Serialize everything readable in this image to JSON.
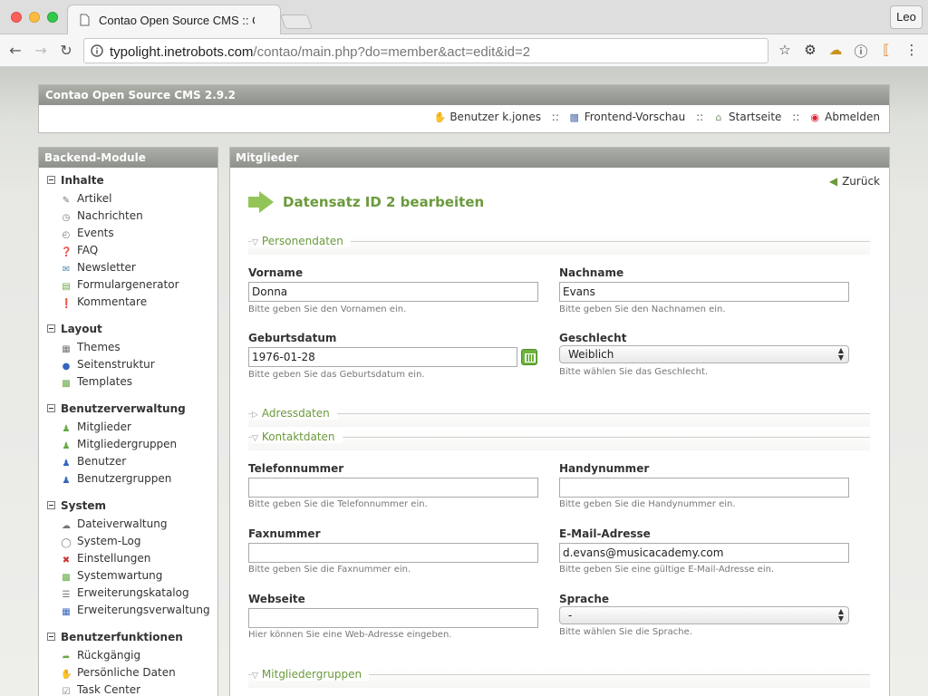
{
  "browser": {
    "tab_title": "Contao Open Source CMS :: Contao",
    "user": "Leo",
    "url_host": "typolight.inetrobots.com",
    "url_path": "/contao/main.php?do=member&act=edit&id=2"
  },
  "header": {
    "title": "Contao Open Source CMS 2.9.2",
    "user_link": "Benutzer k.jones",
    "preview_link": "Frontend-Vorschau",
    "home_link": "Startseite",
    "logout_link": "Abmelden",
    "separator": "::"
  },
  "sidebar": {
    "title": "Backend-Module",
    "groups": [
      {
        "title": "Inhalte",
        "items": [
          "Artikel",
          "Nachrichten",
          "Events",
          "FAQ",
          "Newsletter",
          "Formulargenerator",
          "Kommentare"
        ]
      },
      {
        "title": "Layout",
        "items": [
          "Themes",
          "Seitenstruktur",
          "Templates"
        ]
      },
      {
        "title": "Benutzerverwaltung",
        "items": [
          "Mitglieder",
          "Mitgliedergruppen",
          "Benutzer",
          "Benutzergruppen"
        ]
      },
      {
        "title": "System",
        "items": [
          "Dateiverwaltung",
          "System-Log",
          "Einstellungen",
          "Systemwartung",
          "Erweiterungskatalog",
          "Erweiterungsverwaltung"
        ]
      },
      {
        "title": "Benutzerfunktionen",
        "items": [
          "Rückgängig",
          "Persönliche Daten",
          "Task Center"
        ]
      }
    ]
  },
  "main": {
    "title": "Mitglieder",
    "back": "Zurück",
    "heading": "Datensatz ID 2 bearbeiten",
    "legends": {
      "personal": "Personendaten",
      "address": "Adressdaten",
      "contact": "Kontaktdaten",
      "groups": "Mitgliedergruppen"
    },
    "fields": {
      "firstname": {
        "label": "Vorname",
        "value": "Donna",
        "help": "Bitte geben Sie den Vornamen ein."
      },
      "lastname": {
        "label": "Nachname",
        "value": "Evans",
        "help": "Bitte geben Sie den Nachnamen ein."
      },
      "dob": {
        "label": "Geburtsdatum",
        "value": "1976-01-28",
        "help": "Bitte geben Sie das Geburtsdatum ein."
      },
      "gender": {
        "label": "Geschlecht",
        "value": "Weiblich",
        "help": "Bitte wählen Sie das Geschlecht."
      },
      "phone": {
        "label": "Telefonnummer",
        "value": "",
        "help": "Bitte geben Sie die Telefonnummer ein."
      },
      "mobile": {
        "label": "Handynummer",
        "value": "",
        "help": "Bitte geben Sie die Handynummer ein."
      },
      "fax": {
        "label": "Faxnummer",
        "value": "",
        "help": "Bitte geben Sie die Faxnummer ein."
      },
      "email": {
        "label": "E-Mail-Adresse",
        "value": "d.evans@musicacademy.com",
        "help": "Bitte geben Sie eine gültige E-Mail-Adresse ein."
      },
      "website": {
        "label": "Webseite",
        "value": "",
        "help": "Hier können Sie eine Web-Adresse eingeben."
      },
      "language": {
        "label": "Sprache",
        "value": "-",
        "help": "Bitte wählen Sie die Sprache."
      }
    }
  }
}
